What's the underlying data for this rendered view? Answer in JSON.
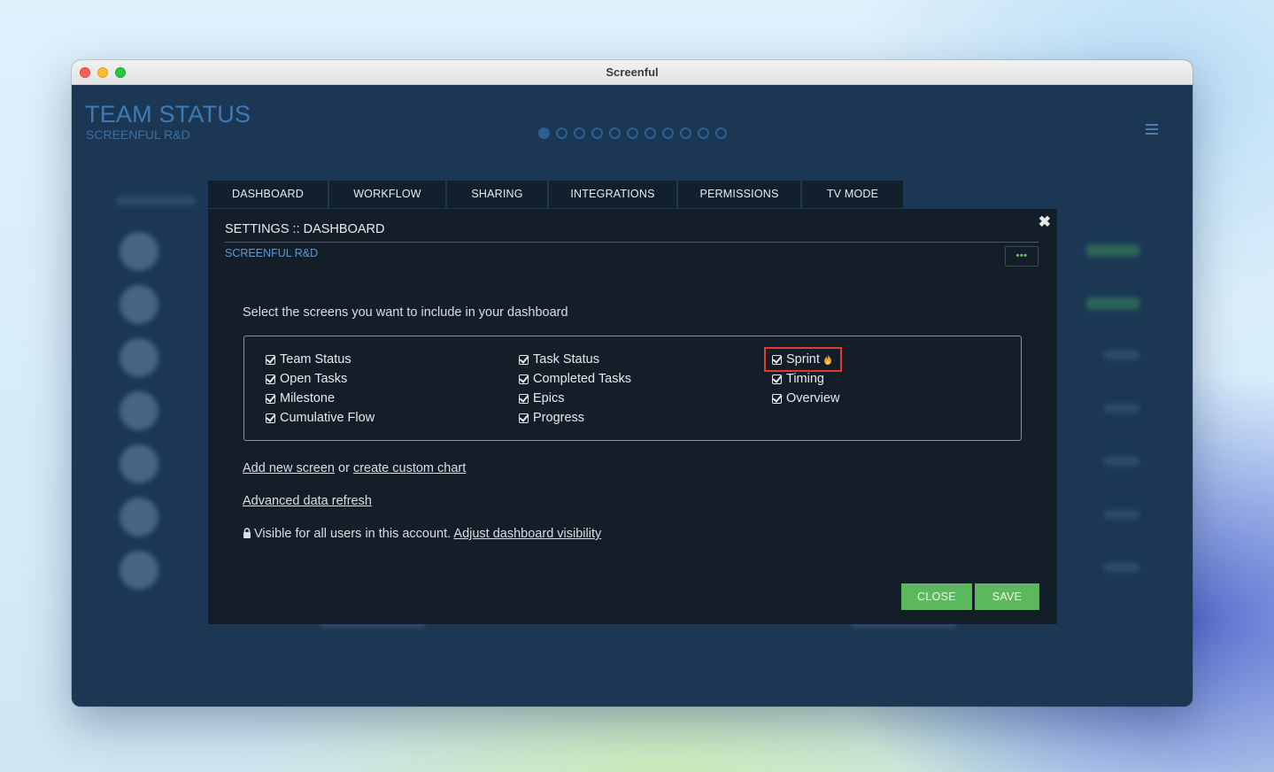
{
  "window": {
    "title": "Screenful"
  },
  "header": {
    "title": "TEAM STATUS",
    "subtitle": "SCREENFUL R&D",
    "page_dots": {
      "count": 11,
      "active_index": 0
    }
  },
  "tabs": [
    {
      "label": "DASHBOARD",
      "active": true
    },
    {
      "label": "WORKFLOW"
    },
    {
      "label": "SHARING"
    },
    {
      "label": "INTEGRATIONS"
    },
    {
      "label": "PERMISSIONS"
    },
    {
      "label": "TV MODE"
    }
  ],
  "modal": {
    "heading": "SETTINGS :: DASHBOARD",
    "account": "SCREENFUL R&D",
    "more_label": "•••",
    "instruction": "Select the screens you want to include in your dashboard",
    "screens": {
      "col1": [
        "Team Status",
        "Open Tasks",
        "Milestone",
        "Cumulative Flow"
      ],
      "col2": [
        "Task Status",
        "Completed Tasks",
        "Epics",
        "Progress"
      ],
      "col3": [
        "Sprint",
        "Timing",
        "Overview"
      ]
    },
    "add_screen": "Add new screen",
    "or_text": " or ",
    "custom_chart": "create custom chart",
    "advanced_refresh": "Advanced data refresh",
    "visibility_text": "Visible for all users in this account. ",
    "visibility_link": "Adjust dashboard visibility",
    "close_label": "CLOSE",
    "save_label": "SAVE"
  },
  "colors": {
    "accent_green": "#5cb85c",
    "highlight_red": "#e23b2e",
    "link_blue": "#5a9bd5"
  }
}
